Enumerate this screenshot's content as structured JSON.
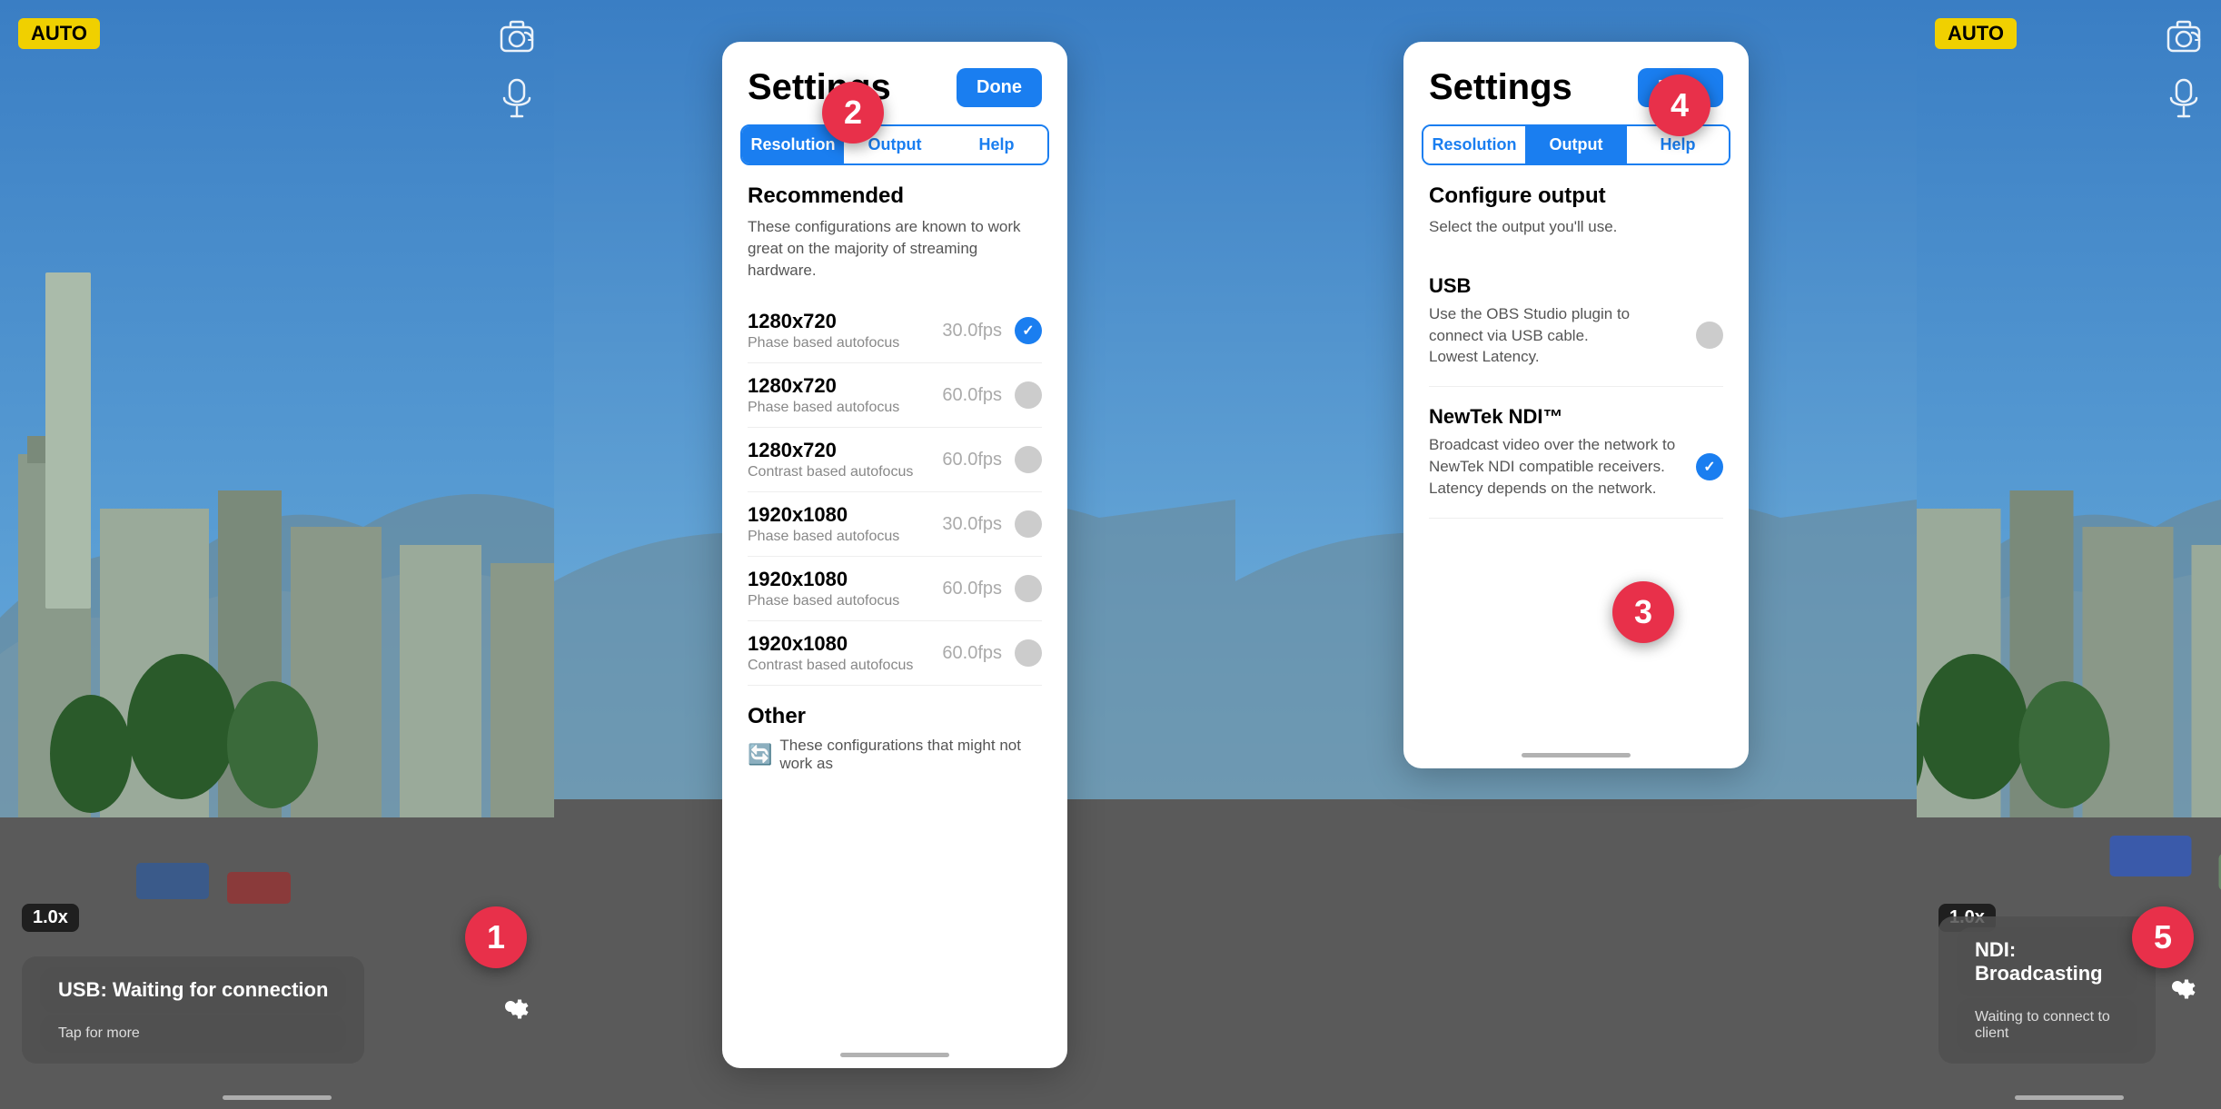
{
  "panels": [
    {
      "id": "camera-left",
      "type": "camera",
      "step_badge": "1",
      "auto_badge": "AUTO",
      "zoom_badge": "1.0x",
      "status": {
        "title": "USB: Waiting for connection",
        "subtitle": "Tap for more"
      },
      "show_gear": true
    },
    {
      "id": "settings-resolution",
      "type": "settings",
      "step_badge": "2",
      "settings": {
        "title": "Settings",
        "done_label": "Done",
        "tabs": [
          {
            "label": "Resolution",
            "active": true
          },
          {
            "label": "Output",
            "active": false
          },
          {
            "label": "Help",
            "active": false
          }
        ],
        "section": "Resolution",
        "recommended": {
          "title": "Recommended",
          "desc": "These configurations are known to work great on the majority of streaming hardware.",
          "items": [
            {
              "res": "1280x720",
              "sub": "Phase based autofocus",
              "fps": "30.0fps",
              "selected": true
            },
            {
              "res": "1280x720",
              "sub": "Phase based autofocus",
              "fps": "60.0fps",
              "selected": false
            },
            {
              "res": "1280x720",
              "sub": "Contrast based autofocus",
              "fps": "60.0fps",
              "selected": false
            },
            {
              "res": "1920x1080",
              "sub": "Phase based autofocus",
              "fps": "30.0fps",
              "selected": false
            },
            {
              "res": "1920x1080",
              "sub": "Phase based autofocus",
              "fps": "60.0fps",
              "selected": false
            },
            {
              "res": "1920x1080",
              "sub": "Contrast based autofocus",
              "fps": "60.0fps",
              "selected": false
            }
          ]
        },
        "other": {
          "title": "Other",
          "desc": "These configurations that might not work as"
        }
      }
    },
    {
      "id": "settings-output",
      "type": "settings",
      "step_badge": "3",
      "settings": {
        "title": "Settings",
        "done_label": "Done",
        "tabs": [
          {
            "label": "Resolution",
            "active": false
          },
          {
            "label": "Output",
            "active": true
          },
          {
            "label": "Help",
            "active": false
          }
        ],
        "section": "Output",
        "configure_output": {
          "title": "Configure output",
          "desc": "Select the output you'll use.",
          "items": [
            {
              "name": "USB",
              "desc": "Use the OBS Studio plugin to connect via USB cable.\nLowest Latency.",
              "selected": false
            },
            {
              "name": "NewTek NDI™",
              "desc": "Broadcast video over the network to NewTek NDI compatible receivers.\nLatency depends on the network.",
              "selected": true
            }
          ]
        }
      }
    },
    {
      "id": "camera-right",
      "type": "camera",
      "step_badge": "4",
      "step_badge2": "5",
      "auto_badge": "AUTO",
      "zoom_badge": "1.0x",
      "status": {
        "title": "NDI: Broadcasting",
        "subtitle": "Waiting to connect to client"
      },
      "show_gear": true
    }
  ],
  "icons": {
    "camera_flip": "⟳",
    "mic": "🎤",
    "gear": "⚙"
  }
}
